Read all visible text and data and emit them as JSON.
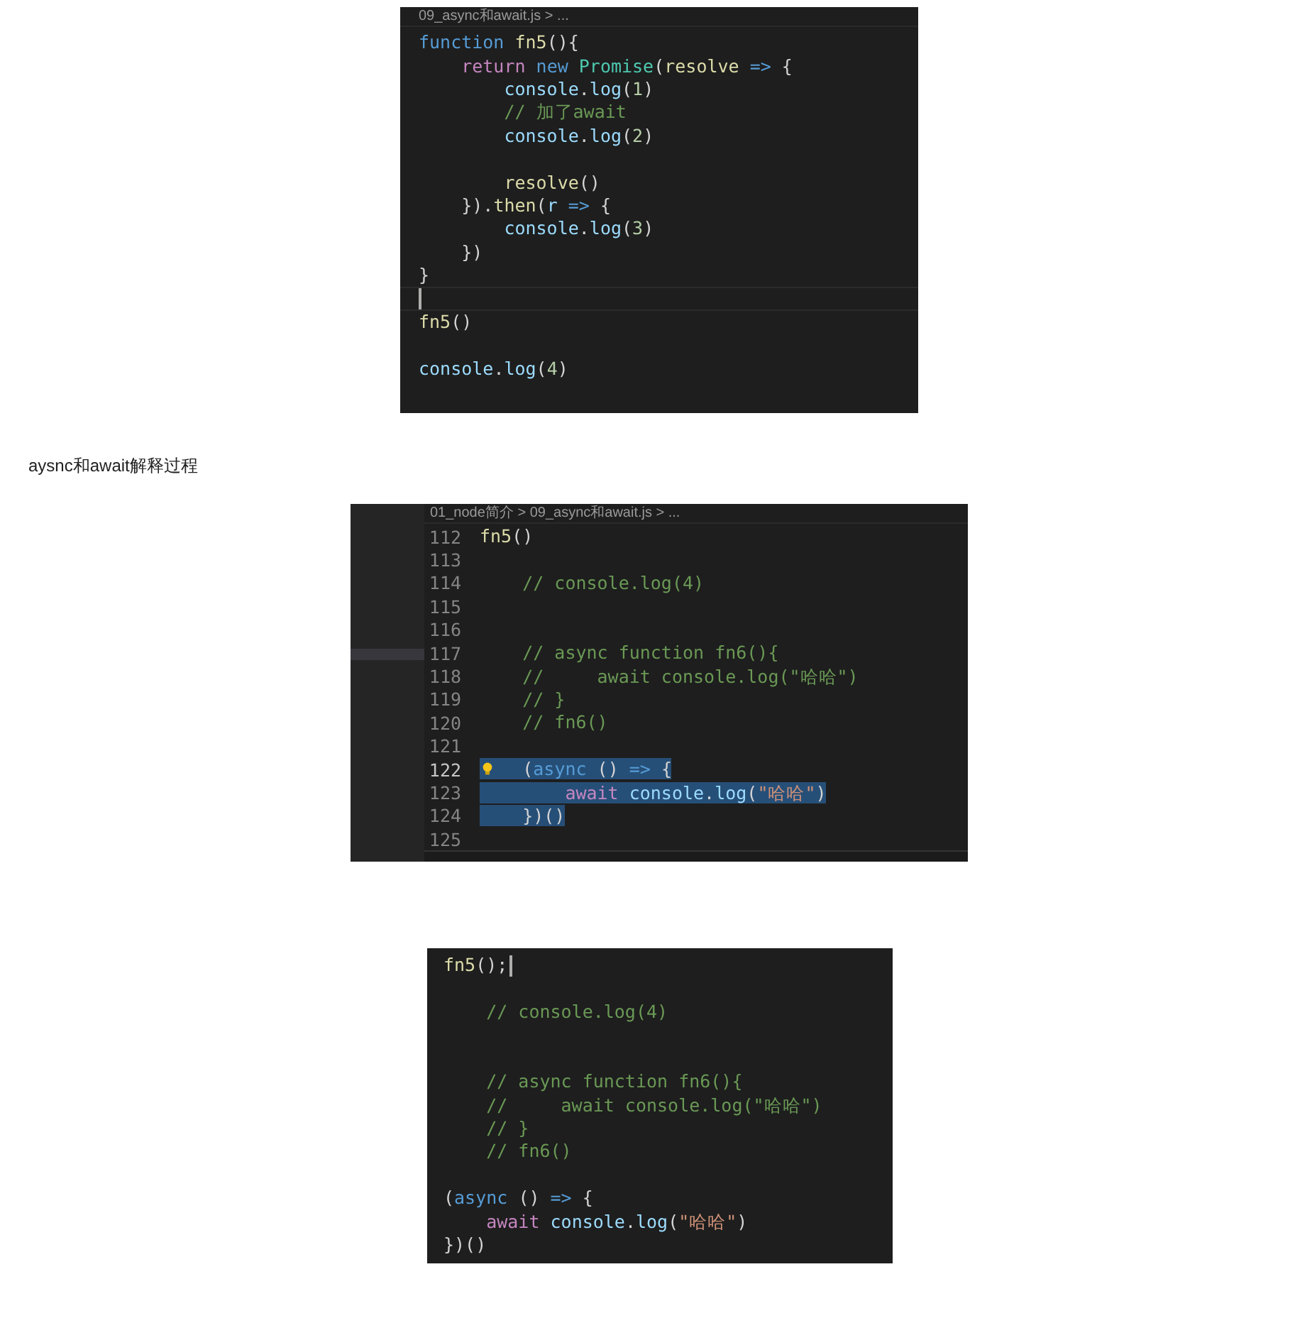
{
  "content": [
    {
      "kind": "editor",
      "breadcrumb": "09_async和await.js > ...",
      "lines": [
        {
          "kind": "code",
          "tokens": [
            {
              "t": "function ",
              "kind": "storage"
            },
            {
              "t": "fn5",
              "kind": "func"
            },
            {
              "t": "(){",
              "kind": "plain"
            }
          ]
        },
        {
          "kind": "code",
          "tokens": [
            {
              "t": "    return ",
              "kind": "control"
            },
            {
              "t": "new ",
              "kind": "storage"
            },
            {
              "t": "Promise",
              "kind": "class"
            },
            {
              "t": "(",
              "kind": "plain"
            },
            {
              "t": "resolve ",
              "kind": "func"
            },
            {
              "t": "=> ",
              "kind": "storage"
            },
            {
              "t": "{",
              "kind": "plain"
            }
          ]
        },
        {
          "kind": "code",
          "tokens": [
            {
              "t": "        console",
              "kind": "var"
            },
            {
              "t": ".",
              "kind": "plain"
            },
            {
              "t": "log",
              "kind": "var"
            },
            {
              "t": "(",
              "kind": "plain"
            },
            {
              "t": "1",
              "kind": "number"
            },
            {
              "t": ")",
              "kind": "plain"
            }
          ]
        },
        {
          "kind": "code",
          "tokens": [
            {
              "t": "        // 加了await",
              "kind": "comment"
            }
          ]
        },
        {
          "kind": "code",
          "tokens": [
            {
              "t": "        console",
              "kind": "var"
            },
            {
              "t": ".",
              "kind": "plain"
            },
            {
              "t": "log",
              "kind": "var"
            },
            {
              "t": "(",
              "kind": "plain"
            },
            {
              "t": "2",
              "kind": "number"
            },
            {
              "t": ")",
              "kind": "plain"
            }
          ]
        },
        {
          "kind": "blank"
        },
        {
          "kind": "code",
          "tokens": [
            {
              "t": "        resolve",
              "kind": "func"
            },
            {
              "t": "()",
              "kind": "plain"
            }
          ]
        },
        {
          "kind": "code",
          "tokens": [
            {
              "t": "    }).",
              "kind": "plain"
            },
            {
              "t": "then",
              "kind": "func"
            },
            {
              "t": "(",
              "kind": "plain"
            },
            {
              "t": "r ",
              "kind": "var"
            },
            {
              "t": "=> ",
              "kind": "storage"
            },
            {
              "t": "{",
              "kind": "plain"
            }
          ]
        },
        {
          "kind": "code",
          "tokens": [
            {
              "t": "        console",
              "kind": "var"
            },
            {
              "t": ".",
              "kind": "plain"
            },
            {
              "t": "log",
              "kind": "var"
            },
            {
              "t": "(",
              "kind": "plain"
            },
            {
              "t": "3",
              "kind": "number"
            },
            {
              "t": ")",
              "kind": "plain"
            }
          ]
        },
        {
          "kind": "code",
          "tokens": [
            {
              "t": "    })",
              "kind": "plain"
            }
          ]
        },
        {
          "kind": "code",
          "tokens": [
            {
              "t": "}",
              "kind": "plain"
            }
          ]
        },
        {
          "kind": "blank",
          "cursor": true
        },
        {
          "kind": "code",
          "tokens": [
            {
              "t": "fn5",
              "kind": "func"
            },
            {
              "t": "()",
              "kind": "plain"
            }
          ]
        },
        {
          "kind": "blank"
        },
        {
          "kind": "code",
          "tokens": [
            {
              "t": "console",
              "kind": "var"
            },
            {
              "t": ".",
              "kind": "plain"
            },
            {
              "t": "log",
              "kind": "var"
            },
            {
              "t": "(",
              "kind": "plain"
            },
            {
              "t": "4",
              "kind": "number"
            },
            {
              "t": ")",
              "kind": "plain"
            }
          ]
        }
      ]
    },
    {
      "kind": "caption",
      "text": "aysnc和await解释过程"
    },
    {
      "kind": "editor",
      "breadcrumb": "01_node简介 > 09_async和await.js > ...",
      "sidebar": true,
      "panel": true,
      "lines": [
        {
          "kind": "code",
          "number": "112",
          "tokens": [
            {
              "t": "fn5",
              "kind": "func"
            },
            {
              "t": "()",
              "kind": "plain"
            }
          ]
        },
        {
          "kind": "blank",
          "number": "113"
        },
        {
          "kind": "code",
          "number": "114",
          "tokens": [
            {
              "t": "    // console.log(4)",
              "kind": "comment"
            }
          ]
        },
        {
          "kind": "blank",
          "number": "115"
        },
        {
          "kind": "blank",
          "number": "116"
        },
        {
          "kind": "code",
          "number": "117",
          "tokens": [
            {
              "t": "    // async function fn6(){",
              "kind": "comment"
            }
          ]
        },
        {
          "kind": "code",
          "number": "118",
          "tokens": [
            {
              "t": "    //     await console.log(\"哈哈\")",
              "kind": "comment"
            }
          ]
        },
        {
          "kind": "code",
          "number": "119",
          "tokens": [
            {
              "t": "    // }",
              "kind": "comment"
            }
          ]
        },
        {
          "kind": "code",
          "number": "120",
          "tokens": [
            {
              "t": "    // fn6()",
              "kind": "comment"
            }
          ]
        },
        {
          "kind": "blank",
          "number": "121"
        },
        {
          "kind": "code",
          "number": "122",
          "current": true,
          "lightbulb": true,
          "tokens": [
            {
              "t": "    (",
              "kind": "plain",
              "selected": true
            },
            {
              "t": "async ",
              "kind": "storage",
              "selected": true
            },
            {
              "t": "() ",
              "kind": "plain",
              "selected": true
            },
            {
              "t": "=> ",
              "kind": "storage",
              "selected": true
            },
            {
              "t": "{",
              "kind": "plain",
              "selected": true
            }
          ]
        },
        {
          "kind": "code",
          "number": "123",
          "tokens": [
            {
              "t": "        await ",
              "kind": "control",
              "selected": true
            },
            {
              "t": "console",
              "kind": "var",
              "selected": true
            },
            {
              "t": ".",
              "kind": "plain",
              "selected": true
            },
            {
              "t": "log",
              "kind": "var",
              "selected": true
            },
            {
              "t": "(",
              "kind": "plain",
              "selected": true
            },
            {
              "t": "\"哈哈\"",
              "kind": "string",
              "selected": true
            },
            {
              "t": ")",
              "kind": "plain",
              "selected": true
            }
          ]
        },
        {
          "kind": "code",
          "number": "124",
          "tokens": [
            {
              "t": "    })()",
              "kind": "plain",
              "selected": true
            }
          ]
        },
        {
          "kind": "blank",
          "number": "125"
        }
      ]
    },
    {
      "kind": "editor",
      "lines": [
        {
          "kind": "code",
          "cursor": true,
          "tokens": [
            {
              "t": "fn5",
              "kind": "func"
            },
            {
              "t": "();",
              "kind": "plain"
            }
          ]
        },
        {
          "kind": "blank"
        },
        {
          "kind": "code",
          "tokens": [
            {
              "t": "    // console.log(4)",
              "kind": "comment"
            }
          ]
        },
        {
          "kind": "blank"
        },
        {
          "kind": "blank"
        },
        {
          "kind": "code",
          "tokens": [
            {
              "t": "    // async function fn6(){",
              "kind": "comment"
            }
          ]
        },
        {
          "kind": "code",
          "tokens": [
            {
              "t": "    //     await console.log(\"哈哈\")",
              "kind": "comment"
            }
          ]
        },
        {
          "kind": "code",
          "tokens": [
            {
              "t": "    // }",
              "kind": "comment"
            }
          ]
        },
        {
          "kind": "code",
          "tokens": [
            {
              "t": "    // fn6()",
              "kind": "comment"
            }
          ]
        },
        {
          "kind": "blank"
        },
        {
          "kind": "code",
          "tokens": [
            {
              "t": "(",
              "kind": "plain"
            },
            {
              "t": "async ",
              "kind": "storage"
            },
            {
              "t": "() ",
              "kind": "plain"
            },
            {
              "t": "=> ",
              "kind": "storage"
            },
            {
              "t": "{",
              "kind": "plain"
            }
          ]
        },
        {
          "kind": "code",
          "tokens": [
            {
              "t": "    await ",
              "kind": "control"
            },
            {
              "t": "console",
              "kind": "var"
            },
            {
              "t": ".",
              "kind": "plain"
            },
            {
              "t": "log",
              "kind": "var"
            },
            {
              "t": "(",
              "kind": "plain"
            },
            {
              "t": "\"哈哈\"",
              "kind": "string"
            },
            {
              "t": ")",
              "kind": "plain"
            }
          ]
        },
        {
          "kind": "code",
          "tokens": [
            {
              "t": "})()",
              "kind": "plain"
            }
          ]
        }
      ]
    }
  ]
}
